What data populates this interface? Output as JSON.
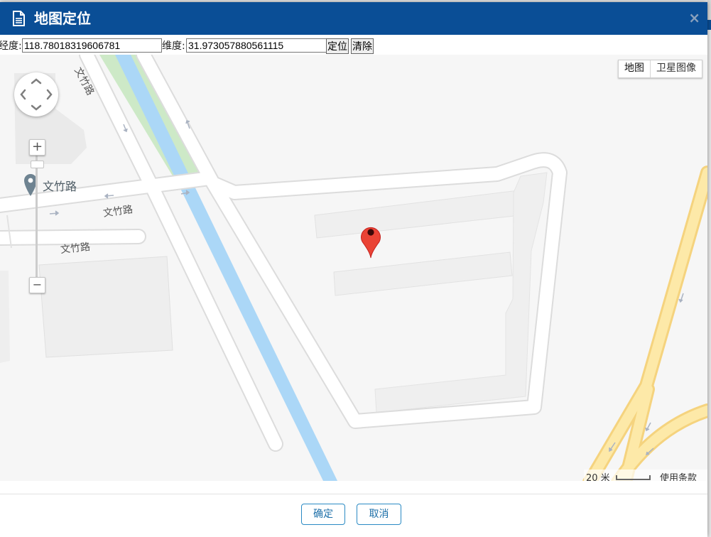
{
  "dialog": {
    "title": "地图定位",
    "close_label": "×"
  },
  "coords": {
    "lng_label": "经度:",
    "lng_value": "118.78018319606781",
    "lat_label": "维度:",
    "lat_value": "31.973057880561115",
    "locate_label": "定位",
    "clear_label": "清除"
  },
  "map": {
    "type_buttons": [
      "地图",
      "卫星图像"
    ],
    "road_labels": [
      "文竹路",
      "文竹路",
      "文竹路"
    ],
    "poi_label": "文竹路",
    "scale_label": "20 米",
    "terms_label": "使用条款",
    "zoom_in": "+",
    "zoom_out": "−"
  },
  "footer": {
    "confirm_label": "确定",
    "cancel_label": "取消"
  }
}
